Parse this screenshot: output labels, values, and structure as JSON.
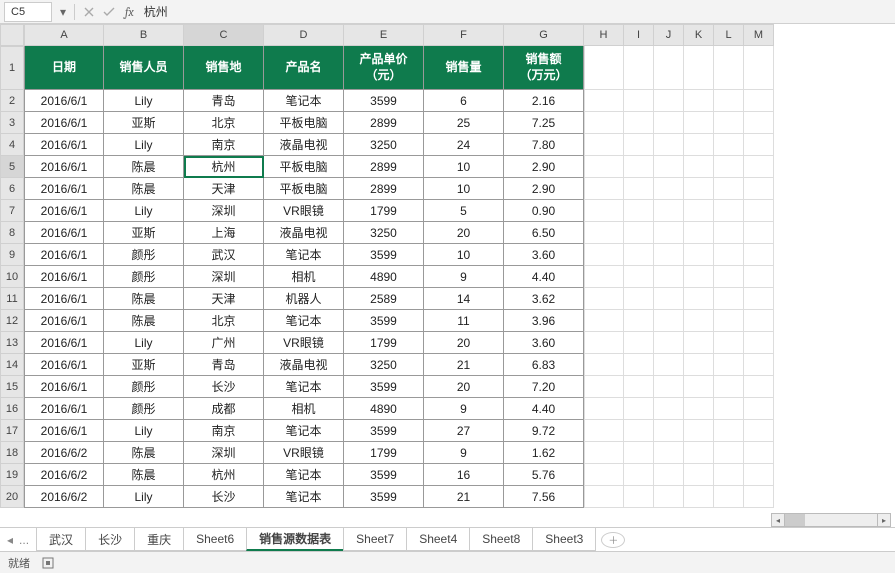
{
  "formula_bar": {
    "cell_ref": "C5",
    "value": "杭州"
  },
  "col_letters": [
    "A",
    "B",
    "C",
    "D",
    "E",
    "F",
    "G",
    "H",
    "I",
    "J",
    "K",
    "L",
    "M"
  ],
  "col_widths_main": [
    80,
    80,
    80,
    80,
    80,
    80,
    80
  ],
  "col_widths_empty": [
    40,
    30,
    30,
    30,
    30,
    30
  ],
  "row_nums": [
    "1",
    "2",
    "3",
    "4",
    "5",
    "6",
    "7",
    "8",
    "9",
    "10",
    "11",
    "12",
    "13",
    "14",
    "15",
    "16",
    "17",
    "18",
    "19",
    "20"
  ],
  "selected_cell": {
    "row": 5,
    "col": "C"
  },
  "chart_data": {
    "type": "table",
    "headers": [
      "日期",
      "销售人员",
      "销售地",
      "产品名",
      "产品单价（元）",
      "销售量",
      "销售额（万元）"
    ],
    "rows": [
      [
        "2016/6/1",
        "Lily",
        "青岛",
        "笔记本",
        "3599",
        "6",
        "2.16"
      ],
      [
        "2016/6/1",
        "亚斯",
        "北京",
        "平板电脑",
        "2899",
        "25",
        "7.25"
      ],
      [
        "2016/6/1",
        "Lily",
        "南京",
        "液晶电视",
        "3250",
        "24",
        "7.80"
      ],
      [
        "2016/6/1",
        "陈晨",
        "杭州",
        "平板电脑",
        "2899",
        "10",
        "2.90"
      ],
      [
        "2016/6/1",
        "陈晨",
        "天津",
        "平板电脑",
        "2899",
        "10",
        "2.90"
      ],
      [
        "2016/6/1",
        "Lily",
        "深圳",
        "VR眼镜",
        "1799",
        "5",
        "0.90"
      ],
      [
        "2016/6/1",
        "亚斯",
        "上海",
        "液晶电视",
        "3250",
        "20",
        "6.50"
      ],
      [
        "2016/6/1",
        "颜彤",
        "武汉",
        "笔记本",
        "3599",
        "10",
        "3.60"
      ],
      [
        "2016/6/1",
        "颜彤",
        "深圳",
        "相机",
        "4890",
        "9",
        "4.40"
      ],
      [
        "2016/6/1",
        "陈晨",
        "天津",
        "机器人",
        "2589",
        "14",
        "3.62"
      ],
      [
        "2016/6/1",
        "陈晨",
        "北京",
        "笔记本",
        "3599",
        "11",
        "3.96"
      ],
      [
        "2016/6/1",
        "Lily",
        "广州",
        "VR眼镜",
        "1799",
        "20",
        "3.60"
      ],
      [
        "2016/6/1",
        "亚斯",
        "青岛",
        "液晶电视",
        "3250",
        "21",
        "6.83"
      ],
      [
        "2016/6/1",
        "颜彤",
        "长沙",
        "笔记本",
        "3599",
        "20",
        "7.20"
      ],
      [
        "2016/6/1",
        "颜彤",
        "成都",
        "相机",
        "4890",
        "9",
        "4.40"
      ],
      [
        "2016/6/1",
        "Lily",
        "南京",
        "笔记本",
        "3599",
        "27",
        "9.72"
      ],
      [
        "2016/6/2",
        "陈晨",
        "深圳",
        "VR眼镜",
        "1799",
        "9",
        "1.62"
      ],
      [
        "2016/6/2",
        "陈晨",
        "杭州",
        "笔记本",
        "3599",
        "16",
        "5.76"
      ],
      [
        "2016/6/2",
        "Lily",
        "长沙",
        "笔记本",
        "3599",
        "21",
        "7.56"
      ]
    ]
  },
  "tabs_prefix": "...",
  "tabs": [
    "武汉",
    "长沙",
    "重庆",
    "Sheet6",
    "销售源数据表",
    "Sheet7",
    "Sheet4",
    "Sheet8",
    "Sheet3"
  ],
  "active_tab": 4,
  "status_text": "就绪",
  "header_multiline": {
    "4": [
      "产品单价",
      "（元）"
    ],
    "6": [
      "销售额",
      "（万元）"
    ]
  }
}
